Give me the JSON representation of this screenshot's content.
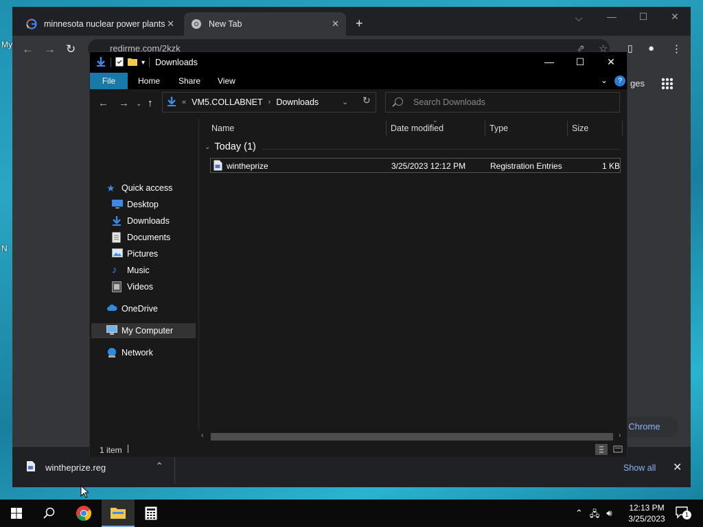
{
  "desktop": {
    "fragments": [
      "My",
      "N"
    ]
  },
  "chrome": {
    "tabs": [
      {
        "title": "minnesota nuclear power plants",
        "favicon": "google-icon",
        "active": false
      },
      {
        "title": "New Tab",
        "favicon": "chrome-icon",
        "active": true
      }
    ],
    "url": "redirme.com/2kzk",
    "images_link": "ges",
    "customize_label": "ze Chrome"
  },
  "download_shelf": {
    "file_name": "wintheprize.reg",
    "show_all_label": "Show all"
  },
  "explorer": {
    "title": "Downloads",
    "ribbon_tabs": [
      "File",
      "Home",
      "Share",
      "View"
    ],
    "breadcrumb": {
      "prefix": "«",
      "items": [
        "VM5.COLLABNET",
        "Downloads"
      ]
    },
    "search_placeholder": "Search Downloads",
    "nav": {
      "quick_access": "Quick access",
      "items": [
        {
          "label": "Desktop",
          "pinned": true,
          "icon": "desktop-icon"
        },
        {
          "label": "Downloads",
          "pinned": true,
          "icon": "downloads-icon"
        },
        {
          "label": "Documents",
          "pinned": true,
          "icon": "documents-icon"
        },
        {
          "label": "Pictures",
          "pinned": true,
          "icon": "pictures-icon"
        },
        {
          "label": "Music",
          "pinned": false,
          "icon": "music-icon"
        },
        {
          "label": "Videos",
          "pinned": false,
          "icon": "videos-icon"
        }
      ],
      "onedrive": "OneDrive",
      "my_computer": "My Computer",
      "network": "Network"
    },
    "columns": {
      "name": "Name",
      "date": "Date modified",
      "type": "Type",
      "size": "Size"
    },
    "group": "Today (1)",
    "files": [
      {
        "name": "wintheprize",
        "date": "3/25/2023 12:12 PM",
        "type": "Registration Entries",
        "size": "1 KB"
      }
    ],
    "status": "1 item"
  },
  "taskbar": {
    "time": "12:13 PM",
    "date": "3/25/2023",
    "notification_count": "1"
  },
  "colors": {
    "accent": "#1979a9",
    "chrome_link": "#8ab4f8",
    "explorer_bg": "#191919"
  }
}
